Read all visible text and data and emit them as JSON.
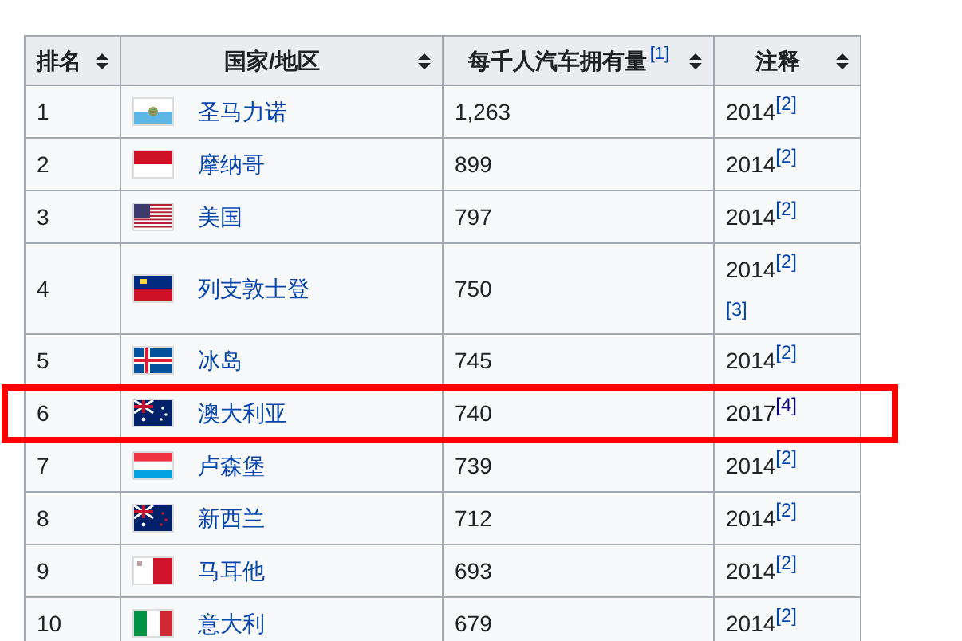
{
  "table": {
    "columns": [
      {
        "label": "排名"
      },
      {
        "label": "国家/地区"
      },
      {
        "label": "每千人汽车拥有量",
        "ref": "[1]"
      },
      {
        "label": "注释"
      }
    ],
    "rows": [
      {
        "rank": "1",
        "country": "圣马力诺",
        "count": "1,263",
        "note": "2014",
        "refs": [
          {
            "text": "[2]",
            "visited": false
          }
        ],
        "highlighted": false
      },
      {
        "rank": "2",
        "country": "摩纳哥",
        "count": "899",
        "note": "2014",
        "refs": [
          {
            "text": "[2]",
            "visited": false
          }
        ],
        "highlighted": false
      },
      {
        "rank": "3",
        "country": "美国",
        "count": "797",
        "note": "2014",
        "refs": [
          {
            "text": "[2]",
            "visited": false
          }
        ],
        "highlighted": false
      },
      {
        "rank": "4",
        "country": "列支敦士登",
        "count": "750",
        "note": "2014",
        "refs": [
          {
            "text": "[2]",
            "visited": false
          },
          {
            "text": "[3]",
            "visited": false
          }
        ],
        "highlighted": false
      },
      {
        "rank": "5",
        "country": "冰岛",
        "count": "745",
        "note": "2014",
        "refs": [
          {
            "text": "[2]",
            "visited": false
          }
        ],
        "highlighted": false
      },
      {
        "rank": "6",
        "country": "澳大利亚",
        "count": "740",
        "note": "2017",
        "refs": [
          {
            "text": "[4]",
            "visited": true
          }
        ],
        "highlighted": true
      },
      {
        "rank": "7",
        "country": "卢森堡",
        "count": "739",
        "note": "2014",
        "refs": [
          {
            "text": "[2]",
            "visited": false
          }
        ],
        "highlighted": false
      },
      {
        "rank": "8",
        "country": "新西兰",
        "count": "712",
        "note": "2014",
        "refs": [
          {
            "text": "[2]",
            "visited": false
          }
        ],
        "highlighted": false
      },
      {
        "rank": "9",
        "country": "马耳他",
        "count": "693",
        "note": "2014",
        "refs": [
          {
            "text": "[2]",
            "visited": false
          }
        ],
        "highlighted": false
      },
      {
        "rank": "10",
        "country": "意大利",
        "count": "679",
        "note": "2014",
        "refs": [
          {
            "text": "[2]",
            "visited": false
          }
        ],
        "highlighted": false
      }
    ]
  }
}
